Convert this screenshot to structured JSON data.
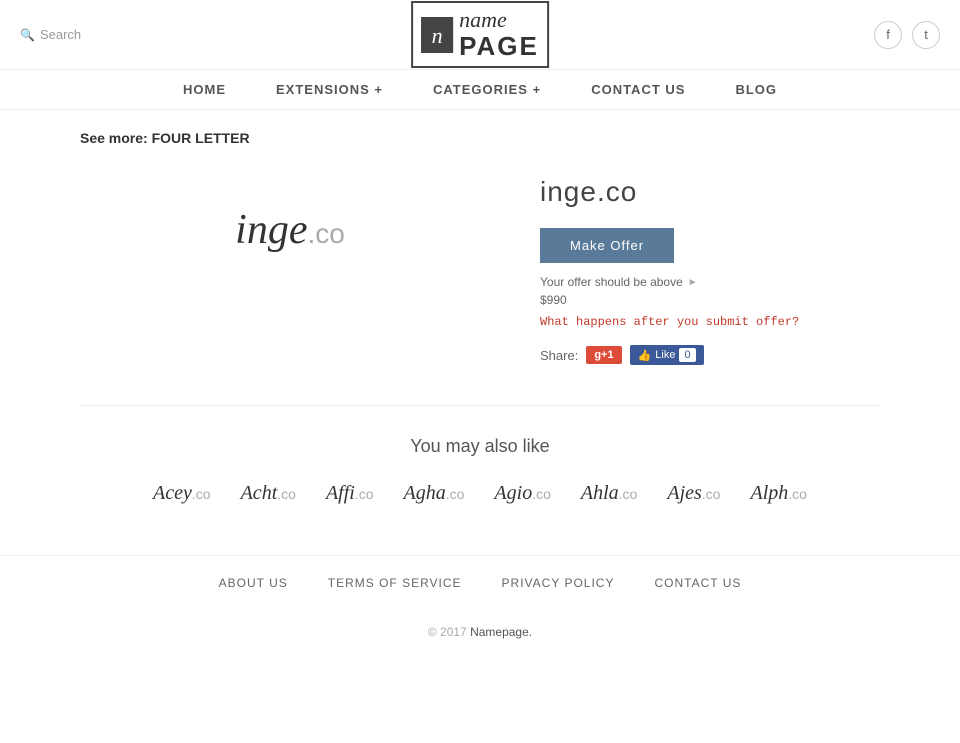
{
  "header": {
    "search_label": "Search",
    "logo_icon": "n",
    "logo_name": "name",
    "logo_page": "PAGE",
    "facebook_icon": "f",
    "twitter_icon": "t"
  },
  "nav": {
    "items": [
      {
        "id": "home",
        "label": "HOME"
      },
      {
        "id": "extensions",
        "label": "EXTENSIONS +"
      },
      {
        "id": "categories",
        "label": "CATEGORIES +"
      },
      {
        "id": "contact",
        "label": "CONTACT US"
      },
      {
        "id": "blog",
        "label": "BLOG"
      }
    ]
  },
  "breadcrumb": {
    "prefix": "See more:",
    "link_text": "FOUR LETTER"
  },
  "domain": {
    "name": "inge",
    "extension": ".co",
    "full": "inge.co",
    "price_hint": "Your offer should be above",
    "price": "$990",
    "make_offer_label": "Make Offer",
    "what_happens": "What happens after you submit offer?",
    "share_label": "Share:",
    "gplus_label": "g+1",
    "fb_label": "Like",
    "fb_count": "0"
  },
  "similar": {
    "title": "You may also like",
    "domains": [
      {
        "name": "Acey",
        "ext": ".co"
      },
      {
        "name": "Acht",
        "ext": ".co"
      },
      {
        "name": "Affi",
        "ext": ".co"
      },
      {
        "name": "Agha",
        "ext": ".co"
      },
      {
        "name": "Agio",
        "ext": ".co"
      },
      {
        "name": "Ahla",
        "ext": ".co"
      },
      {
        "name": "Ajes",
        "ext": ".co"
      },
      {
        "name": "Alph",
        "ext": ".co"
      }
    ]
  },
  "footer": {
    "links": [
      {
        "id": "about",
        "label": "ABOUT US"
      },
      {
        "id": "terms",
        "label": "TERMS OF SERVICE"
      },
      {
        "id": "privacy",
        "label": "PRIVACY POLICY"
      },
      {
        "id": "contact",
        "label": "CONTACT US"
      }
    ],
    "copyright": "© 2017",
    "site_name": "Namepage."
  }
}
